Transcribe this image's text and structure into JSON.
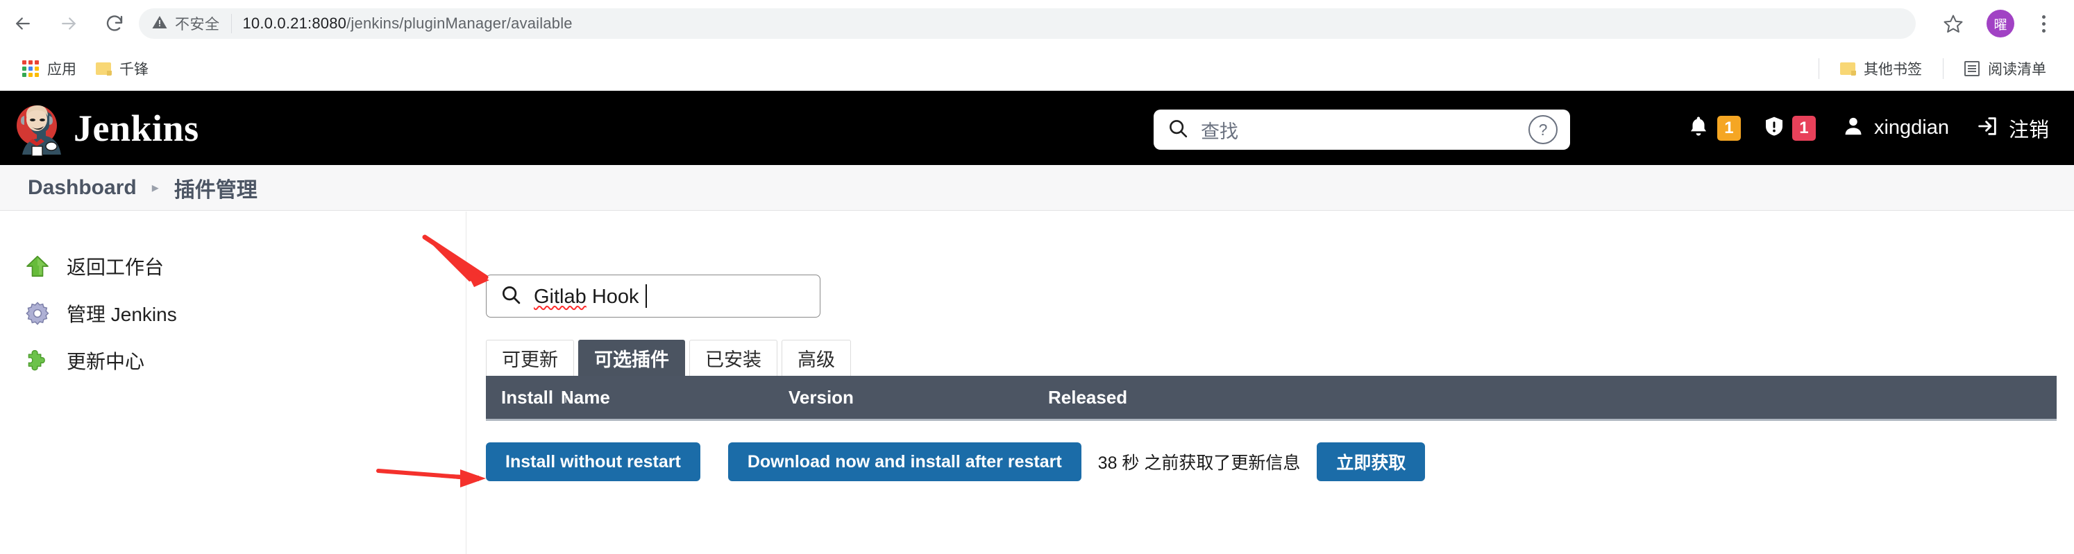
{
  "browser": {
    "back_icon": "arrow-left-icon",
    "forward_icon": "arrow-right-icon",
    "reload_icon": "reload-icon",
    "security_warning": "不安全",
    "url_host": "10.0.0.21:8080",
    "url_path": "/jenkins/pluginManager/available",
    "star_icon": "bookmark-star-icon",
    "avatar_text": "曜",
    "menu_icon": "kebab-menu-icon",
    "bookmarks": {
      "apps_label": "应用",
      "items": [
        {
          "label": "千锋",
          "icon": "folder-icon"
        }
      ],
      "right_items": [
        {
          "label": "其他书签",
          "icon": "folder-icon"
        },
        {
          "label": "阅读清单",
          "icon": "reading-list-icon"
        }
      ]
    }
  },
  "jenkins": {
    "brand_title": "Jenkins",
    "brand_logo": "jenkins-butler-logo",
    "search_placeholder": "查找",
    "search_icon": "search-icon",
    "help_icon": "help-circle-icon",
    "notifications": {
      "icon": "bell-icon",
      "count": "1",
      "color": "#f5a623"
    },
    "security": {
      "icon": "shield-alert-icon",
      "count": "1",
      "color": "#e8415a"
    },
    "user": {
      "icon": "person-icon",
      "name": "xingdian"
    },
    "logout": {
      "icon": "logout-icon",
      "label": "注销"
    }
  },
  "breadcrumb": {
    "separator": "▸",
    "items": [
      {
        "label": "Dashboard"
      },
      {
        "label": "插件管理"
      }
    ]
  },
  "sidebar": {
    "items": [
      {
        "label": "返回工作台",
        "icon": "up-arrow-green-icon"
      },
      {
        "label": "管理 Jenkins",
        "icon": "gear-icon"
      },
      {
        "label": "更新中心",
        "icon": "puzzle-piece-green-icon"
      }
    ]
  },
  "main": {
    "plugin_search": {
      "icon": "search-icon",
      "value_misspelled": "Gitlab",
      "value_rest": " Hook",
      "caret": true
    },
    "tabs": [
      {
        "label": "可更新",
        "active": false
      },
      {
        "label": "可选插件",
        "active": true
      },
      {
        "label": "已安装",
        "active": false
      },
      {
        "label": "高级",
        "active": false
      }
    ],
    "table": {
      "columns": [
        {
          "label": "Install",
          "sort": "↑"
        },
        {
          "label": "Name",
          "sort": ""
        },
        {
          "label": "Version",
          "sort": ""
        },
        {
          "label": "Released",
          "sort": ""
        }
      ],
      "rows": []
    },
    "actions": {
      "install_without_restart": "Install without restart",
      "download_now": "Download now and install after restart",
      "update_note": "38 秒 之前获取了更新信息",
      "check_now": "立即获取"
    }
  },
  "annotations": {
    "arrow_color": "#f4312c",
    "arrows": [
      {
        "name": "arrow-to-plugin-search"
      },
      {
        "name": "arrow-to-install-button"
      }
    ]
  }
}
